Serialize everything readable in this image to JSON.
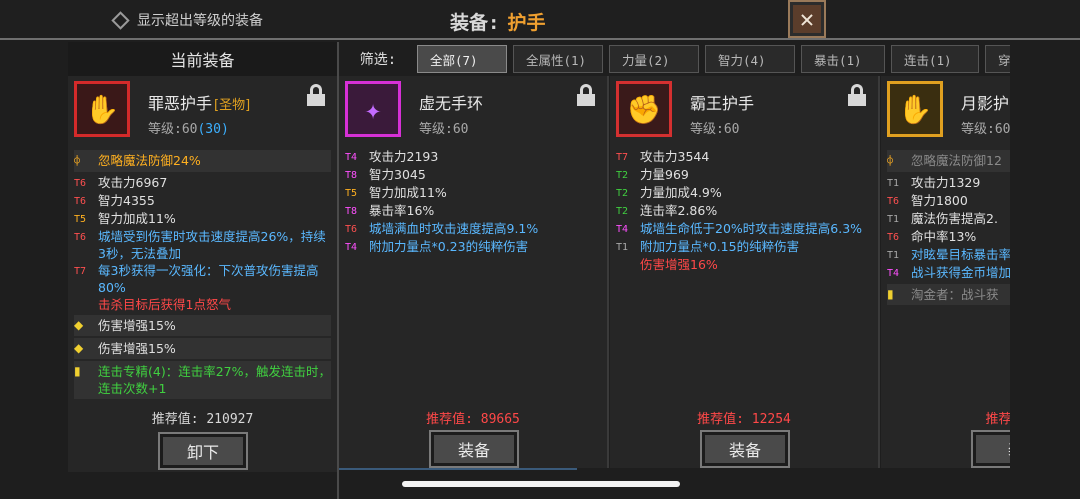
{
  "top": {
    "show_over_label": "显示超出等级的装备",
    "equip_label": "装备:",
    "slot_label": "护手",
    "close_label": "✕"
  },
  "current": {
    "header": "当前装备",
    "name": "罪恶护手",
    "tag": "[圣物]",
    "level_prefix": "等级:60",
    "level_bonus": "(30)",
    "stats": [
      {
        "tier": "",
        "text": "忽略魔法防御24%"
      },
      {
        "tier": "T6",
        "text": "攻击力6967"
      },
      {
        "tier": "T6",
        "text": "智力4355"
      },
      {
        "tier": "T5",
        "text": "智力加成11%"
      },
      {
        "tier": "T6",
        "text": "城墙受到伤害时攻击速度提高26%，持续3秒，无法叠加"
      },
      {
        "tier": "T7",
        "text": "每3秒获得一次强化：下次普攻伤害提高80%"
      },
      {
        "tier": "",
        "text": "击杀目标后获得1点怒气"
      }
    ],
    "gems": [
      "伤害增强15%",
      "伤害增强15%"
    ],
    "set_bonus": "连击专精(4)：连击率27%，触发连击时，连击次数+1",
    "recommend": "推荐值: 210927",
    "unequip_label": "卸下"
  },
  "filter": {
    "label": "筛选:",
    "items": [
      "全部(7)",
      "全属性(1)",
      "力量(2)",
      "智力(4)",
      "暴击(1)",
      "连击(1)",
      "穿"
    ]
  },
  "cards": [
    {
      "name": "虚无手环",
      "level": "等级:60",
      "stats": [
        {
          "tier": "T4",
          "text": "攻击力2193"
        },
        {
          "tier": "T8",
          "text": "智力3045"
        },
        {
          "tier": "T5",
          "text": "智力加成11%"
        },
        {
          "tier": "T8",
          "text": "暴击率16%"
        },
        {
          "tier": "T6",
          "text": "城墙满血时攻击速度提高9.1%"
        },
        {
          "tier": "T4",
          "text": "附加力量点*0.23的纯粹伤害"
        }
      ],
      "recommend": "推荐值: 89665",
      "equip_label": "装备"
    },
    {
      "name": "霸王护手",
      "level": "等级:60",
      "stats": [
        {
          "tier": "T7",
          "text": "攻击力3544"
        },
        {
          "tier": "T2",
          "text": "力量969"
        },
        {
          "tier": "T2",
          "text": "力量加成4.9%"
        },
        {
          "tier": "T2",
          "text": "连击率2.86%"
        },
        {
          "tier": "T4",
          "text": "城墙生命低于20%时攻击速度提高6.3%"
        },
        {
          "tier": "T1",
          "text": "附加力量点*0.15的纯粹伤害"
        },
        {
          "tier": "",
          "text": "伤害增强16%"
        }
      ],
      "recommend": "推荐值: 12254",
      "equip_label": "装备"
    },
    {
      "name": "月影护",
      "level": "等级:60",
      "stats": [
        {
          "tier": "",
          "text": "忽略魔法防御12"
        },
        {
          "tier": "T1",
          "text": "攻击力1329"
        },
        {
          "tier": "T6",
          "text": "智力1800"
        },
        {
          "tier": "T1",
          "text": "魔法伤害提高2."
        },
        {
          "tier": "T6",
          "text": "命中率13%"
        },
        {
          "tier": "T1",
          "text": "对眩晕目标暴击率"
        },
        {
          "tier": "T4",
          "text": "战斗获得金币增加"
        },
        {
          "tier": "",
          "text": "淘金者：战斗获"
        }
      ],
      "recommend": "推荐值",
      "equip_label": "装"
    }
  ]
}
